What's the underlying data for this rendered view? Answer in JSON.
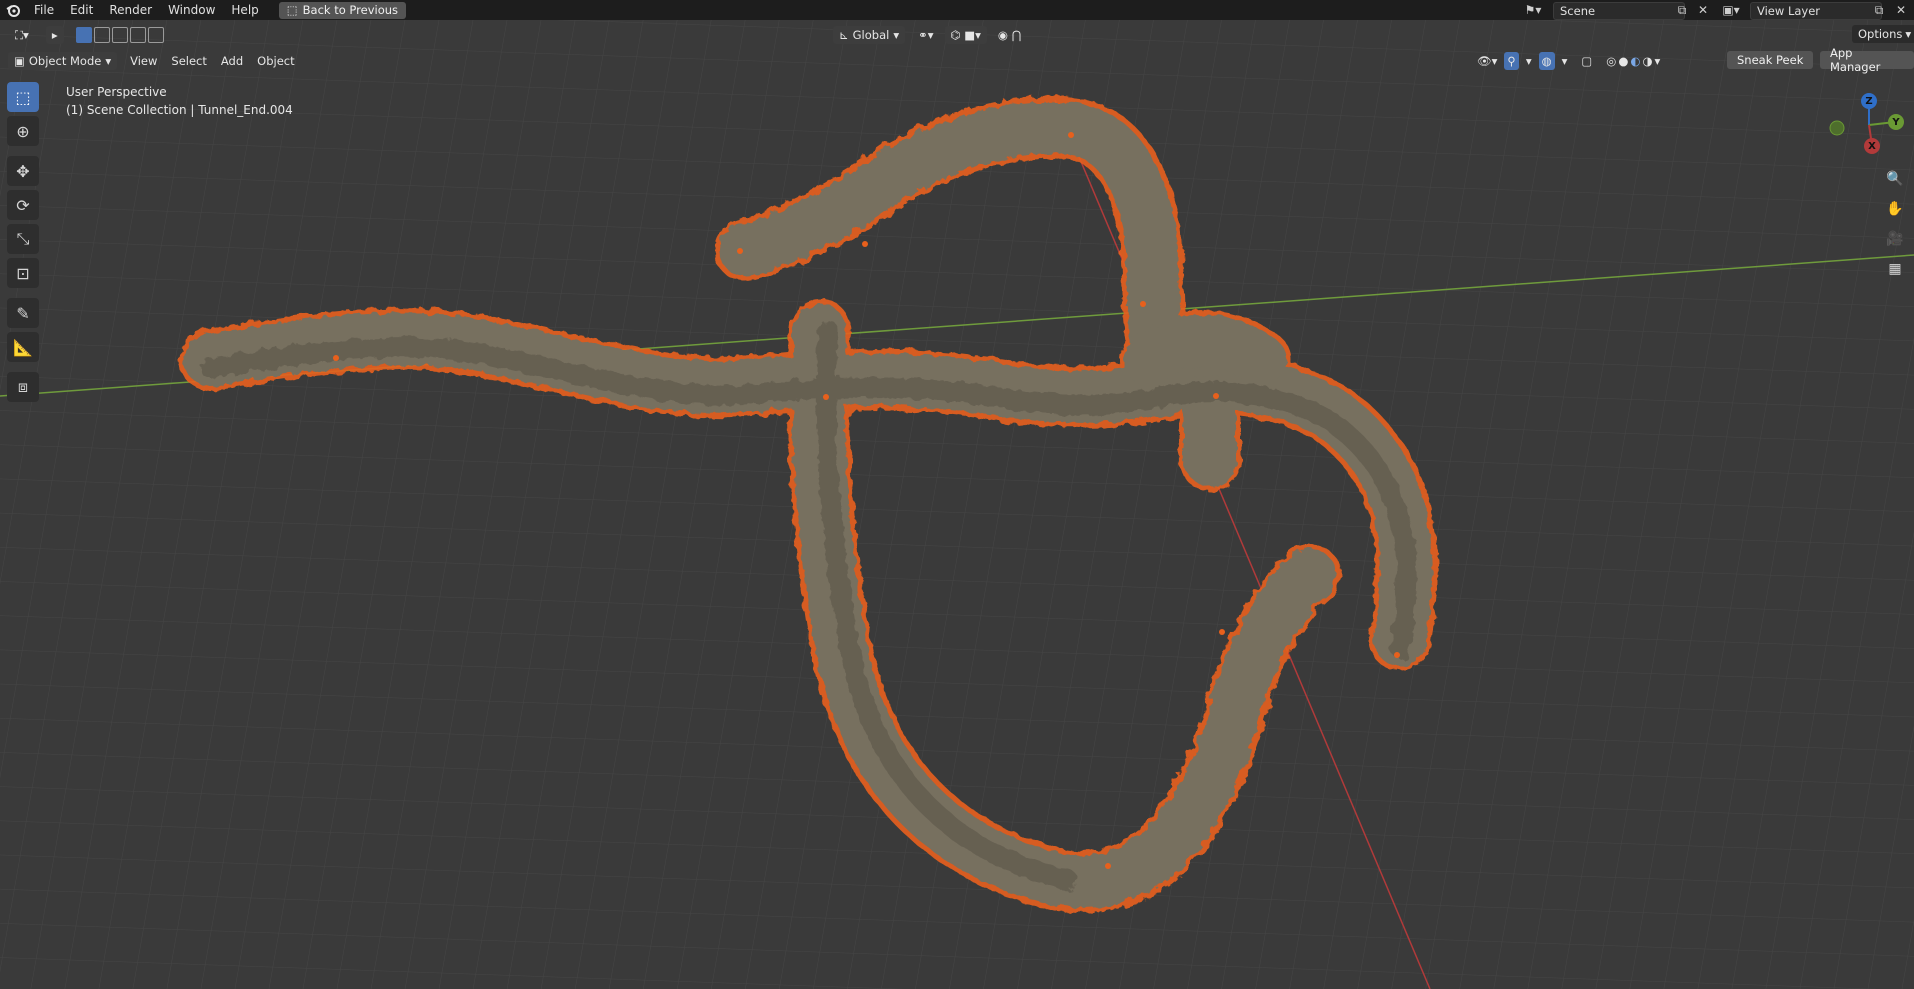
{
  "menu": {
    "items": [
      "File",
      "Edit",
      "Render",
      "Window",
      "Help"
    ],
    "back_label": "Back to Previous",
    "scene_name": "Scene",
    "view_layer": "View Layer"
  },
  "header": {
    "transform_orientation": "Global",
    "options_label": "Options"
  },
  "viewport_header": {
    "mode": "Object Mode",
    "menus": [
      "View",
      "Select",
      "Add",
      "Object"
    ],
    "sneak_peek_label": "Sneak Peek",
    "app_manager_label": "App Manager"
  },
  "viewport_info": {
    "perspective": "User Perspective",
    "collection": "(1) Scene Collection | Tunnel_End.004"
  },
  "gizmo": {
    "z": "Z",
    "y": "Y",
    "x": "X"
  },
  "colors": {
    "selection_outline": "#e8601c",
    "active_tool": "#4772b3",
    "x_axis": "#b23a3a",
    "y_axis": "#6a9a34"
  }
}
